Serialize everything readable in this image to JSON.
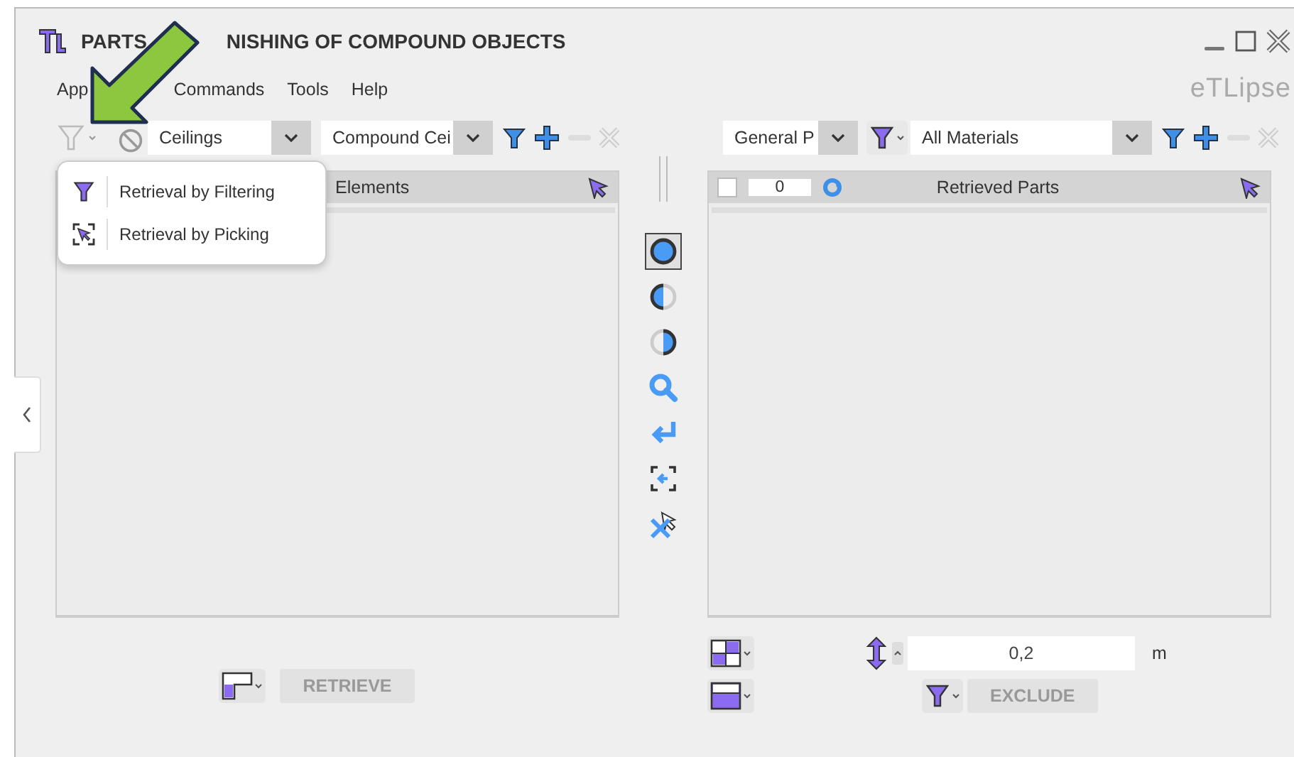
{
  "window": {
    "title_parts": [
      "PARTS",
      "NISHING OF COMPOUND OBJECTS"
    ],
    "brand": "eTLipse"
  },
  "menu": [
    "App",
    "Commands",
    "Tools",
    "Help"
  ],
  "left_toolbar": {
    "category": "Ceilings",
    "type": "Compound Cei"
  },
  "right_toolbar": {
    "category": "General P",
    "material": "All Materials"
  },
  "left_panel": {
    "header": "Elements"
  },
  "right_panel": {
    "checked": false,
    "count": "0",
    "header": "Retrieved Parts"
  },
  "popup_menu": [
    {
      "kind": "filter",
      "label": "Retrieval by Filtering"
    },
    {
      "kind": "pick",
      "label": "Retrieval by Picking"
    }
  ],
  "tools": [
    {
      "kind": "full",
      "selected": true
    },
    {
      "kind": "left-half",
      "selected": false
    },
    {
      "kind": "right-half",
      "selected": false
    },
    {
      "kind": "search",
      "selected": false
    },
    {
      "kind": "return",
      "selected": false
    },
    {
      "kind": "pick-back",
      "selected": false
    },
    {
      "kind": "unpick",
      "selected": false
    }
  ],
  "bottom": {
    "retrieve": {
      "label": "RETRIEVE",
      "disabled": true
    },
    "offset": {
      "value": "0,2",
      "unit": "m"
    },
    "exclude": {
      "label": "EXCLUDE",
      "disabled": true
    }
  }
}
